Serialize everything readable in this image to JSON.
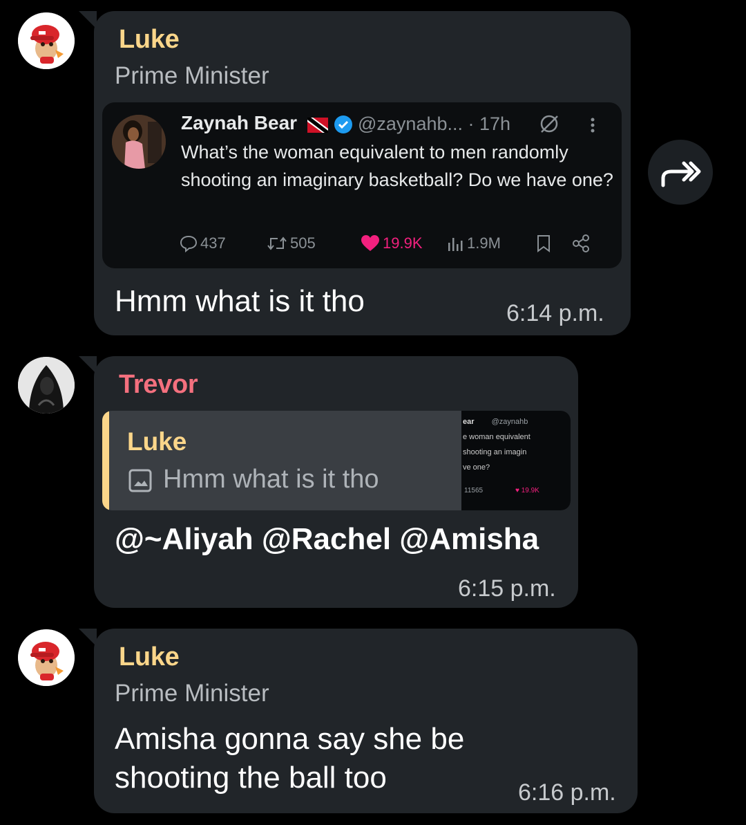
{
  "messages": [
    {
      "sender": "Luke",
      "role": "Prime Minister",
      "avatar_icon": "red-cap-character-avatar",
      "tweet": {
        "name": "Zaynah Bear",
        "handle": "@zaynahb...",
        "time": "· 17h",
        "text": "What’s the woman equivalent to men randomly shooting an imaginary basketball? Do we have one?",
        "replies": "437",
        "retweets": "505",
        "likes": "19.9K",
        "views": "1.9M"
      },
      "text": "Hmm what is it tho",
      "time": "6:14 p.m."
    },
    {
      "sender": "Trevor",
      "avatar_icon": "hooded-figure-avatar",
      "reply": {
        "sender": "Luke",
        "text": "Hmm what is it tho"
      },
      "text": "@~Aliyah @Rachel @Amisha",
      "time": "6:15 p.m."
    },
    {
      "sender": "Luke",
      "role": "Prime Minister",
      "avatar_icon": "red-cap-character-avatar",
      "text_line1": "Amisha gonna say she be",
      "text_line2": "shooting the ball too",
      "time": "6:16 p.m."
    }
  ],
  "thumb": {
    "line1": "ear",
    "line1b": "@zaynahb",
    "line2": "e woman equivalent",
    "line3": "shooting an imagin",
    "line4": "ve one?",
    "stat1": "11565",
    "stat2": "19.9K"
  },
  "colors": {
    "bubble": "#212529",
    "luke_name": "#fbd68a",
    "trevor_name": "#f4707e",
    "like": "#f2207e"
  }
}
